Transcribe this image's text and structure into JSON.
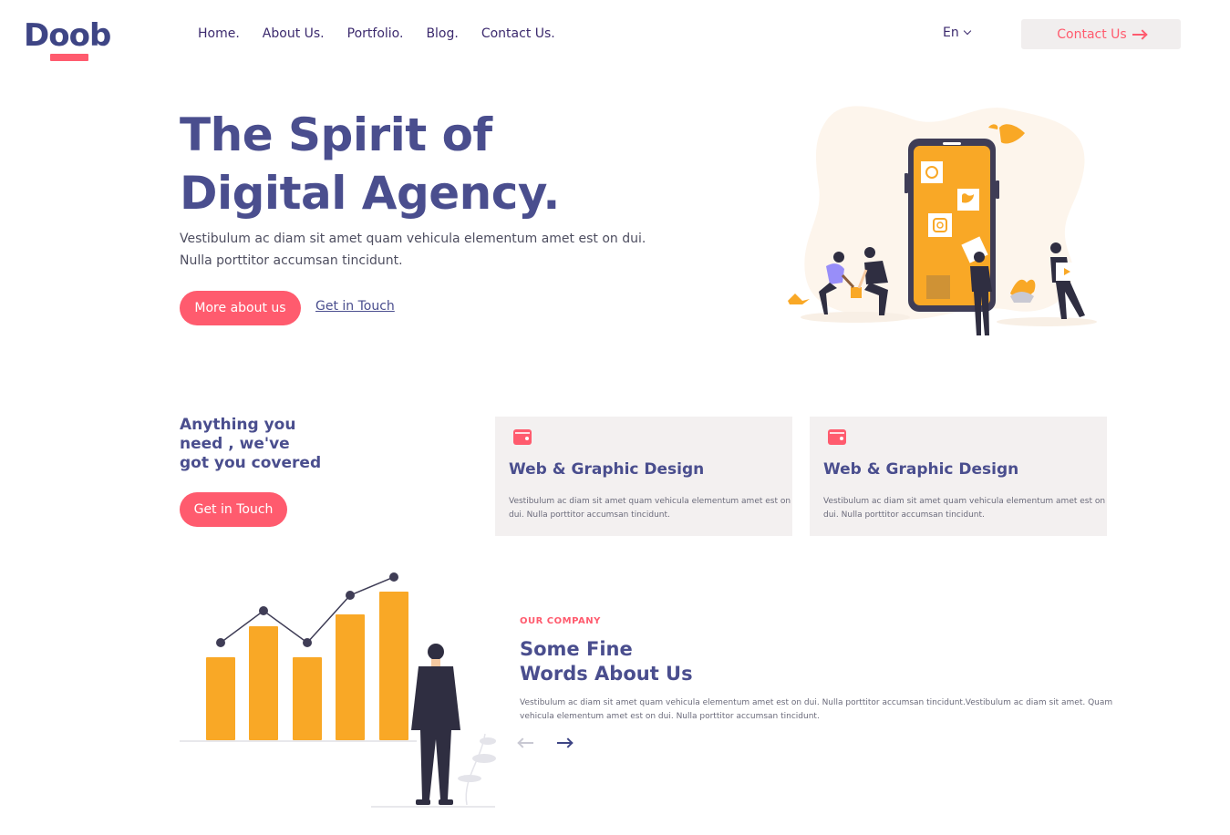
{
  "brand": {
    "logo_text": "Doob"
  },
  "nav": {
    "items": [
      {
        "label": "Home."
      },
      {
        "label": "About Us."
      },
      {
        "label": "Portfolio."
      },
      {
        "label": "Blog."
      },
      {
        "label": "Contact Us."
      }
    ],
    "language": "En",
    "contact_button": "Contact Us"
  },
  "hero": {
    "title_line1": "The Spirit of",
    "title_line2": "Digital Agency.",
    "subtitle_line1": "Vestibulum ac diam sit amet quam vehicula elementum amet est on dui.",
    "subtitle_line2": "Nulla porttitor accumsan tincidunt.",
    "primary_button": "More about us",
    "secondary_link": "Get in Touch"
  },
  "services": {
    "heading_line1": "Anything you",
    "heading_line2": "need , we've",
    "heading_line3": "got you covered",
    "button": "Get in Touch",
    "cards": [
      {
        "title": "Web & Graphic Design",
        "text": "Vestibulum ac diam sit amet quam vehicula elementum amet est on dui. Nulla porttitor accumsan tincidunt."
      },
      {
        "title": "Web & Graphic Design",
        "text": "Vestibulum ac diam sit amet quam vehicula elementum amet est on dui. Nulla porttitor accumsan tincidunt."
      }
    ]
  },
  "company": {
    "label": "OUR COMPANY",
    "title_line1": "Some Fine",
    "title_line2": "Words About Us",
    "text": "Vestibulum ac diam sit amet quam vehicula elementum amet est on dui. Nulla porttitor accumsan tincidunt.Vestibulum ac diam sit amet. Quam vehicula elementum amet est on dui. Nulla porttitor accumsan tincidunt."
  },
  "colors": {
    "primary": "#4a4e8e",
    "accent": "#ff5b6e",
    "card_bg": "#f3f0f0",
    "illustration_yellow": "#f9a826"
  },
  "icons": {
    "nav_chevron": "chevron-down-icon",
    "contact_arrow": "arrow-right-icon",
    "card_icon": "wallet-icon",
    "prev": "arrow-left-icon",
    "next": "arrow-right-icon"
  }
}
